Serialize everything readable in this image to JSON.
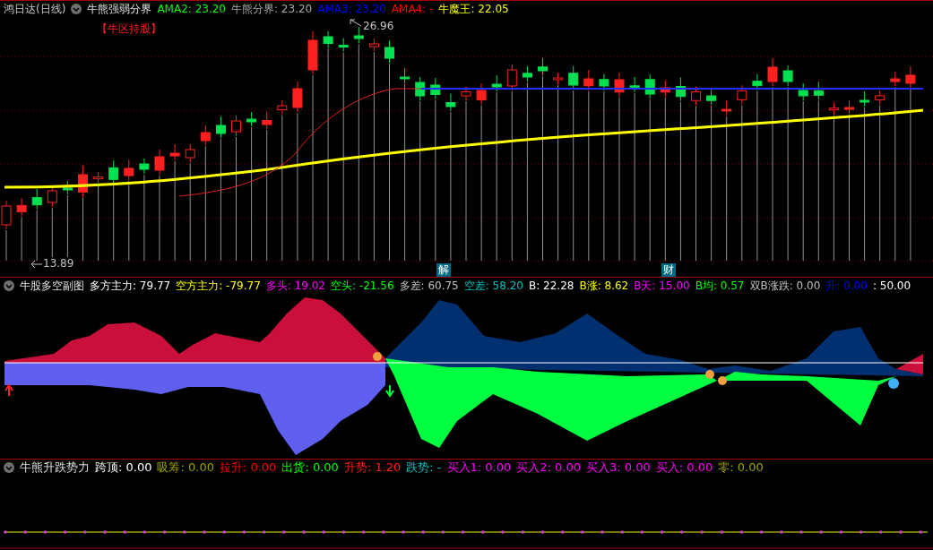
{
  "main_panel": {
    "title": "鸿日达(日线)",
    "indicator": "牛熊强弱分界",
    "readings": [
      {
        "text": "AMA2: 23.20",
        "color": "#00ff00"
      },
      {
        "text": "牛熊分界: 23.20",
        "color": "#a8a8a8"
      },
      {
        "text": "AMA3: 23.20",
        "color": "#0000ff"
      },
      {
        "text": "AMA4: -",
        "color": "#ff0000"
      },
      {
        "text": "牛魔王: 22.05",
        "color": "#ffff00"
      }
    ],
    "zone_label": "【牛区持股】",
    "high_label": "26.96",
    "low_label": "13.89",
    "event_tags": [
      "解",
      "财"
    ]
  },
  "sub_panel": {
    "indicator": "牛股多空副图",
    "readings": [
      {
        "text": "多方主力: 79.77",
        "color": "#ffffff"
      },
      {
        "text": "空方主力: -79.77",
        "color": "#ffff00"
      },
      {
        "text": "多头: 19.02",
        "color": "#ff00ff"
      },
      {
        "text": "空头: -21.56",
        "color": "#00ff00"
      },
      {
        "text": "多差: 60.75",
        "color": "#c0c0c0"
      },
      {
        "text": "空差: 58.20",
        "color": "#00c0c0"
      },
      {
        "text": "B: 22.28",
        "color": "#ffffff"
      },
      {
        "text": "B涨: 8.62",
        "color": "#ffff00"
      },
      {
        "text": "B天: 15.00",
        "color": "#ff00ff"
      },
      {
        "text": "B均: 0.57",
        "color": "#00ff00"
      },
      {
        "text": "双B涨跌: 0.00",
        "color": "#c0c0c0"
      },
      {
        "text": "升: 0.00",
        "color": "#0000ff"
      },
      {
        "text": ": 50.00",
        "color": "#ffffff"
      }
    ]
  },
  "bottom_panel": {
    "indicator": "牛熊升跌势力",
    "readings": [
      {
        "text": "跨顶: 0.00",
        "color": "#ffffff"
      },
      {
        "text": "吸筹: 0.00",
        "color": "#a0a000"
      },
      {
        "text": "拉升: 0.00",
        "color": "#ff0000"
      },
      {
        "text": "出货: 0.00",
        "color": "#00ff00"
      },
      {
        "text": "升势: 1.20",
        "color": "#ff2020"
      },
      {
        "text": "跌势: -",
        "color": "#00c4c4"
      },
      {
        "text": "买入1: 0.00",
        "color": "#ff00ff"
      },
      {
        "text": "买入2: 0.00",
        "color": "#ff00fe"
      },
      {
        "text": "买入3: 0.00",
        "color": "#fe00ff"
      },
      {
        "text": "买入: 0.00",
        "color": "#ff01ff"
      },
      {
        "text": "零: 0.00",
        "color": "#a0a001"
      }
    ]
  }
}
